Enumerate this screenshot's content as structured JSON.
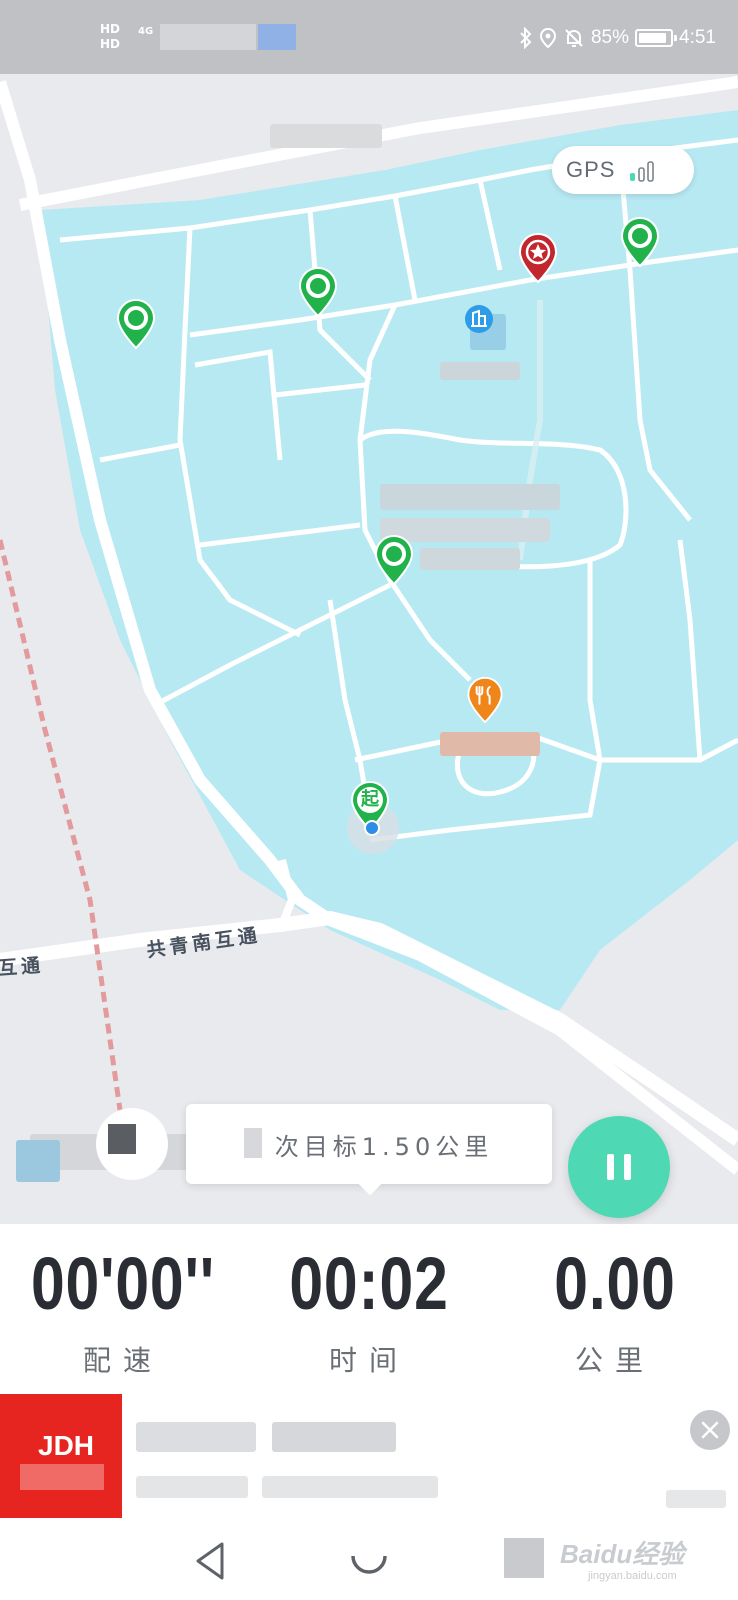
{
  "status_bar": {
    "network_badges": [
      "HD",
      "HD"
    ],
    "signal": "4G",
    "battery_percent": "85%",
    "time": "4:51",
    "icons": [
      "bluetooth-icon",
      "location-icon",
      "bell-off-icon",
      "battery-icon"
    ]
  },
  "map": {
    "gps_label": "GPS",
    "gps_signal_level": 3,
    "road_labels": [
      "共青南互通",
      "互通"
    ],
    "start_marker_label": "起",
    "markers": [
      "checkpoint-pin",
      "checkpoint-pin",
      "checkpoint-pin",
      "checkpoint-pin",
      "star-pin",
      "food-pin",
      "building-pin",
      "start-pin"
    ],
    "goal_text": "次目标1.50公里"
  },
  "stats": {
    "pace_value": "00'00''",
    "pace_label": "配速",
    "time_value": "00:02",
    "time_label": "时间",
    "distance_value": "0.00",
    "distance_label": "公里"
  },
  "ad": {
    "logo_text": "JDH"
  },
  "watermark": {
    "brand": "Baidu经验",
    "url": "jingyan.baidu.com"
  },
  "colors": {
    "water": "#b7e9f3",
    "land": "#e9eaee",
    "pin_green": "#21b24b",
    "pin_red": "#c1272d",
    "pin_orange": "#f08519",
    "accent_teal": "#4ed8b3",
    "ad_red": "#e62521"
  }
}
